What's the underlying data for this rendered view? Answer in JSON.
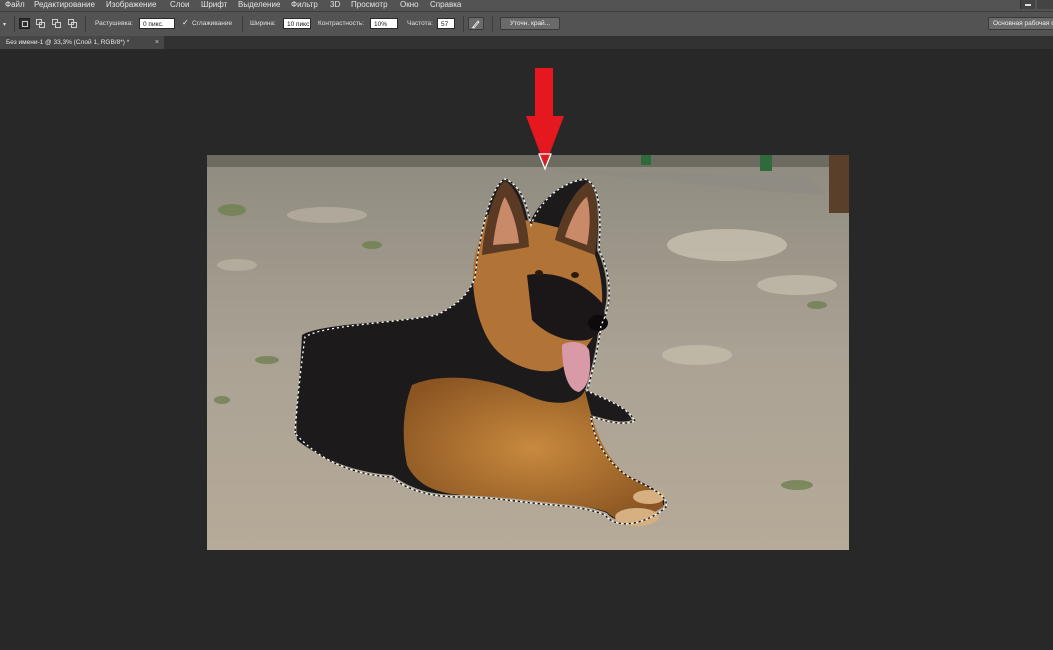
{
  "menu": [
    "Файл",
    "Редактирование",
    "Изображение",
    "Слои",
    "Шрифт",
    "Выделение",
    "Фильтр",
    "3D",
    "Просмотр",
    "Окно",
    "Справка"
  ],
  "options": {
    "feather_label": "Растушевка:",
    "feather_value": "0 пикс.",
    "antialias_label": "Сглаживание",
    "width_label": "Ширина:",
    "width_value": "10 пикс",
    "contrast_label": "Контрастность:",
    "contrast_value": "10%",
    "frequency_label": "Частота:",
    "frequency_value": "57",
    "refine_edge_label": "Уточн. край...",
    "workspace_label": "Основная рабочая с"
  },
  "document": {
    "tab_title": "Без имени-1 @ 33,3% (Слой 1, RGB/8*) *",
    "close_glyph": "×"
  },
  "colors": {
    "arrow": "#e5171f",
    "panel": "#535353",
    "workspace": "#282828"
  },
  "icons": [
    "magnetic-lasso-tool-icon",
    "new-selection-icon",
    "add-selection-icon",
    "subtract-selection-icon",
    "intersect-selection-icon",
    "checkbox-checked-icon",
    "stylus-pressure-icon",
    "red-arrow-annotation-icon"
  ]
}
